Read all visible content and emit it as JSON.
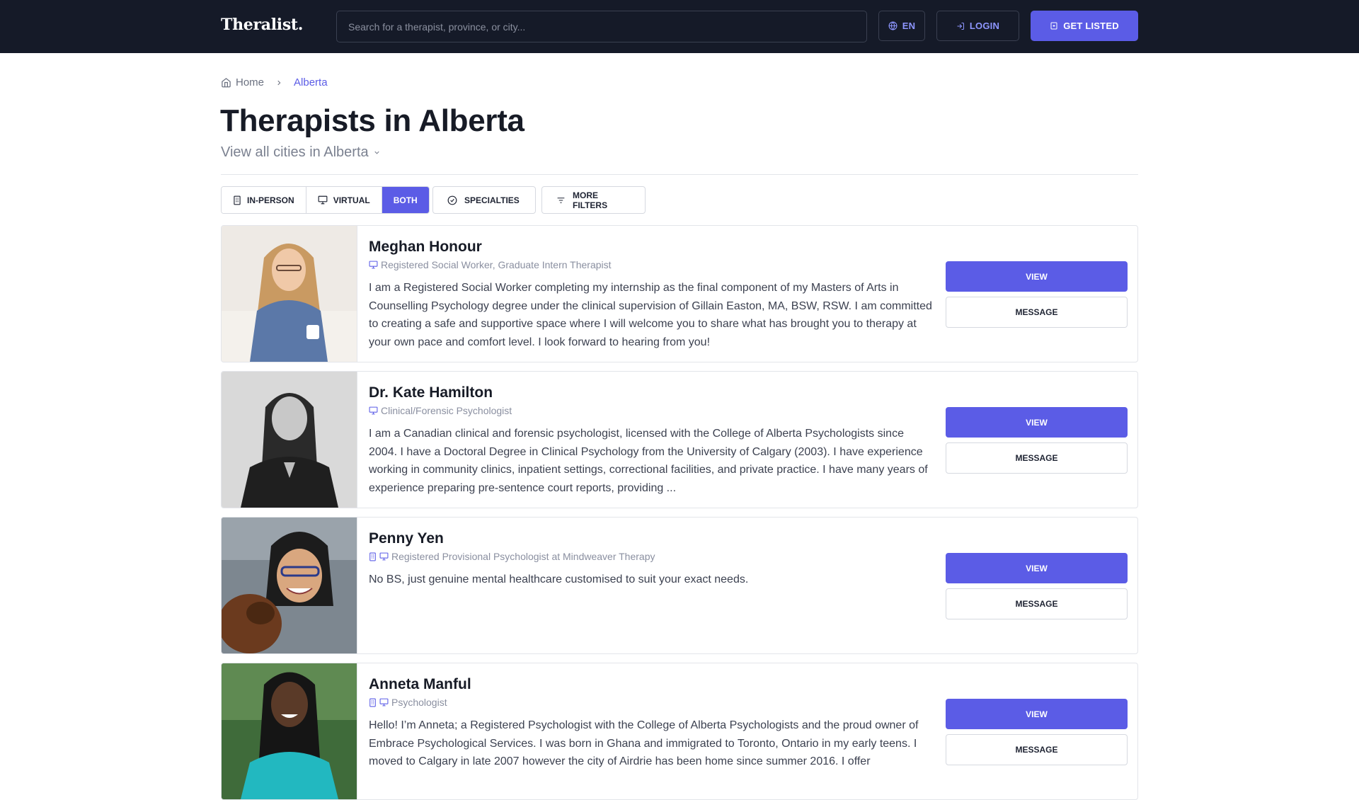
{
  "header": {
    "logo": "Theralist.",
    "search_placeholder": "Search for a therapist, province, or city...",
    "lang_label": "EN",
    "login_label": "LOGIN",
    "get_listed_label": "GET LISTED"
  },
  "breadcrumb": {
    "home": "Home",
    "current": "Alberta"
  },
  "page": {
    "title": "Therapists in Alberta",
    "cities_link": "View all cities in Alberta"
  },
  "filters": {
    "in_person": "IN-PERSON",
    "virtual": "VIRTUAL",
    "both": "BOTH",
    "specialties": "SPECIALTIES",
    "more_filters": "MORE FILTERS",
    "active": "both"
  },
  "therapists": [
    {
      "name": "Meghan Honour",
      "role": "Registered Social Worker, Graduate Intern Therapist",
      "modes": [
        "virtual"
      ],
      "bio": "I am a Registered Social Worker completing my internship as the final component of my Masters of Arts in Counselling Psychology degree under the clinical supervision of Gillain Easton, MA, BSW, RSW. I am committed to creating a safe and supportive space where I will welcome you to share what has brought you to therapy at your own pace and comfort level. I look forward to hearing from you!",
      "view_label": "VIEW",
      "message_label": "MESSAGE"
    },
    {
      "name": "Dr. Kate Hamilton",
      "role": "Clinical/Forensic Psychologist",
      "modes": [
        "virtual"
      ],
      "bio": "I am a Canadian clinical and forensic psychologist, licensed with the College of Alberta Psychologists since 2004. I have a Doctoral Degree in Clinical Psychology from the University of Calgary (2003). I have experience working in community clinics, inpatient settings, correctional facilities, and private practice. I have many years of experience preparing pre-sentence court reports, providing ...",
      "view_label": "VIEW",
      "message_label": "MESSAGE"
    },
    {
      "name": "Penny Yen",
      "role": "Registered Provisional Psychologist at Mindweaver Therapy",
      "modes": [
        "in-person",
        "virtual"
      ],
      "bio": "No BS, just genuine mental healthcare customised to suit your exact needs.",
      "view_label": "VIEW",
      "message_label": "MESSAGE"
    },
    {
      "name": "Anneta Manful",
      "role": "Psychologist",
      "modes": [
        "in-person",
        "virtual"
      ],
      "bio": "Hello! I’m Anneta; a Registered Psychologist with the College of Alberta Psychologists and the proud owner of Embrace Psychological Services. I was born in Ghana and immigrated to Toronto, Ontario in my early teens. I moved to Calgary in late 2007 however the city of Airdrie has been home since summer 2016. I offer",
      "view_label": "VIEW",
      "message_label": "MESSAGE"
    }
  ],
  "colors": {
    "header_bg": "#151a28",
    "accent": "#5b5ce6"
  }
}
